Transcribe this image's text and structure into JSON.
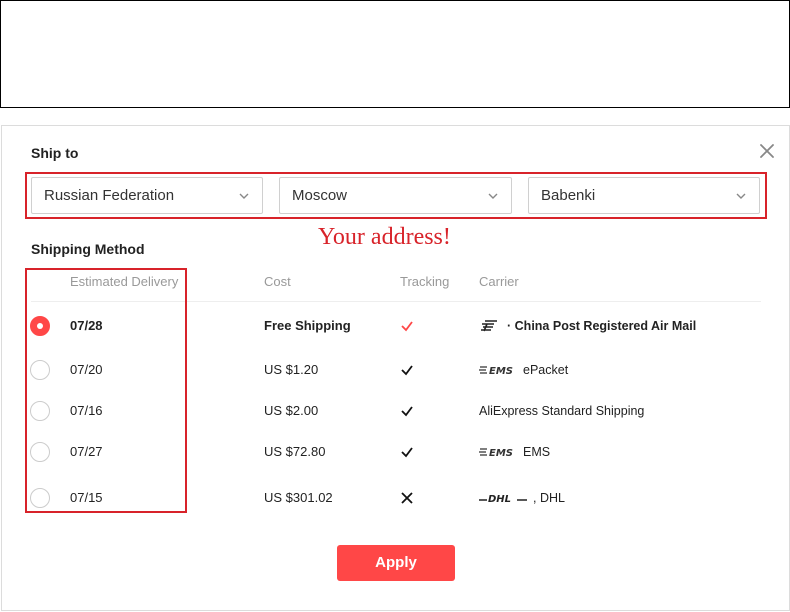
{
  "ship_to": {
    "title": "Ship to",
    "country": "Russian Federation",
    "region": "Moscow",
    "city": "Babenki",
    "annotation": "Your address!"
  },
  "shipping_method": {
    "title": "Shipping Method",
    "columns": [
      "Estimated Delivery",
      "Cost",
      "Tracking",
      "Carrier"
    ],
    "rows": [
      {
        "date": "07/28",
        "cost": "Free Shipping",
        "tracking": "check-red",
        "carrier_logo": "china-post-logo",
        "carrier_prefix": "·",
        "carrier": "China Post Registered Air Mail",
        "selected": true
      },
      {
        "date": "07/20",
        "cost": "US $1.20",
        "tracking": "check",
        "carrier_logo": "ems-logo",
        "carrier_prefix": "",
        "carrier": "ePacket",
        "selected": false
      },
      {
        "date": "07/16",
        "cost": "US $2.00",
        "tracking": "check",
        "carrier_logo": "",
        "carrier_prefix": "",
        "carrier": "AliExpress Standard Shipping",
        "selected": false
      },
      {
        "date": "07/27",
        "cost": "US $72.80",
        "tracking": "check",
        "carrier_logo": "ems-logo",
        "carrier_prefix": "",
        "carrier": "EMS",
        "selected": false
      },
      {
        "date": "07/15",
        "cost": "US $301.02",
        "tracking": "cross",
        "carrier_logo": "dhl-logo",
        "carrier_prefix": ",",
        "carrier": "DHL",
        "selected": false
      }
    ]
  },
  "apply_label": "Apply",
  "colors": {
    "accent": "#ff4747",
    "annotation": "#d8232a",
    "border": "#d0d0d0",
    "muted": "#999999"
  }
}
